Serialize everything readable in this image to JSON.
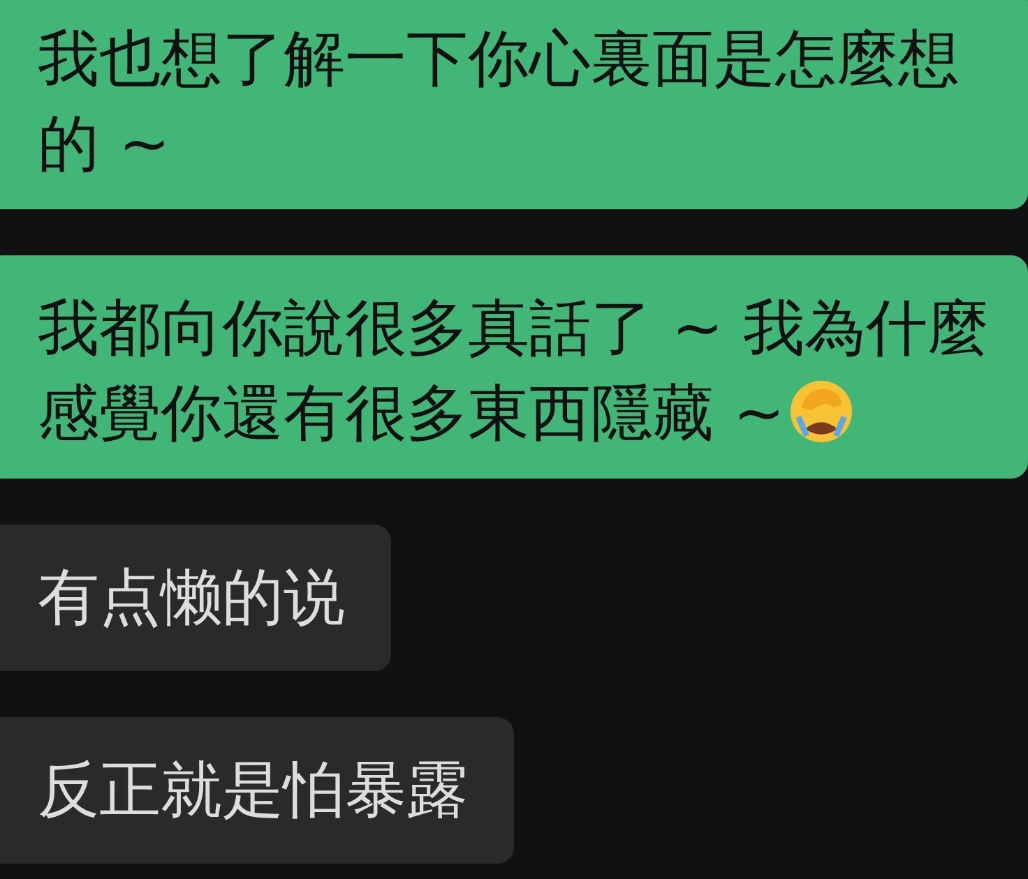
{
  "messages": [
    {
      "kind": "sent",
      "text": "我也想了解一下你心裏面是怎麼想的 ~"
    },
    {
      "kind": "sent",
      "text": "我都向你說很多真話了 ~ 我為什麼感覺你還有很多東西隱藏 ~",
      "emoji": true
    },
    {
      "kind": "received",
      "text": "有点懒的说"
    },
    {
      "kind": "received",
      "text": "反正就是怕暴露"
    }
  ]
}
